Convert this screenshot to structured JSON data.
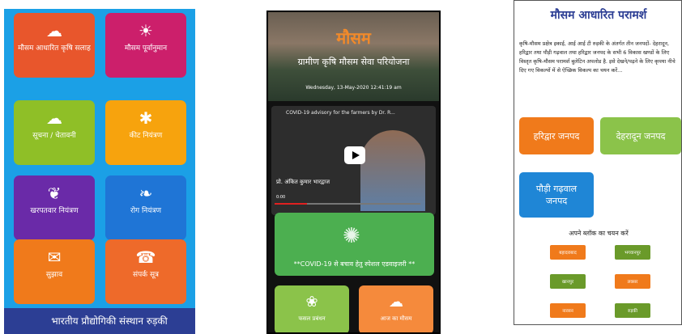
{
  "screen1": {
    "tiles": [
      {
        "label": "मौसम आधारित कृषि सलाह",
        "icon": "cloud-warning-icon",
        "color": "#e8562c"
      },
      {
        "label": "मौसम पूर्वानुमान",
        "icon": "weather-forecast-icon",
        "color": "#cc1f6b"
      },
      {
        "label": "सूचना / चेतावनी",
        "icon": "cloud-alert-icon",
        "color": "#8fbf27"
      },
      {
        "label": "कीट नियंत्रण",
        "icon": "insect-icon",
        "color": "#f7a30d"
      },
      {
        "label": "खरपतवार नियंत्रण",
        "icon": "weed-icon",
        "color": "#6a2aa8"
      },
      {
        "label": "रोग नियंत्रण",
        "icon": "plant-disease-icon",
        "color": "#1f75d6"
      },
      {
        "label": "सुझाव",
        "icon": "mail-icon",
        "color": "#f07a1b"
      },
      {
        "label": "संपर्क सूत्र",
        "icon": "phone-icon",
        "color": "#ee6a2a"
      }
    ],
    "footer": "भारतीय प्रौद्योगिकी संस्थान रुड़की"
  },
  "screen2": {
    "title": "मौसम",
    "subtitle": "ग्रामीण कृषि मौसम सेवा परियोजना",
    "date": "Wednesday, 13-May-2020 12:41:19 am",
    "video_title": "COVID-19 advisory for the farmers by Dr. R...",
    "video_caption": "प्रो. अंकित कुमार भारद्वाज",
    "video_time": "0:00",
    "covid_text": "**COVID-19 से बचाव हेतु स्पेशल एडवाइजरी **",
    "bottom_tiles": [
      {
        "label": "फसल प्रबंधन",
        "color": "#8bc34a"
      },
      {
        "label": "आज का मौसम",
        "color": "#f58a3c"
      }
    ]
  },
  "screen3": {
    "title": "मौसम आधारित परामर्श",
    "description": "कृषि-मौसम प्रक्षेत्र इकाई, आई आई टी रुड़की के अंतर्गत तीन जनपदों- देहरादून, हरिद्वार तथा पौड़ी गढ़वाल तथा हरिद्वार जनपद के सभी 6 विकास खण्डों के लिए विस्तृत कृषि-मौसम परामर्श बुलेटिन अपलोड है. इसे देखने/पढ़ने के लिए कृपया नीचे दिए गए विकल्पों में से ऐच्छिक विकल्प का चयन करें...",
    "districts": [
      {
        "label": "हरिद्वार जनपद",
        "color": "#f07a1b"
      },
      {
        "label": "देहरादून जनपद",
        "color": "#8bc34a"
      },
      {
        "label": "पौड़ी गढ़वाल जनपद",
        "color": "#1f86d6"
      }
    ],
    "block_label": "अपने ब्लॉक का चयन करें",
    "blocks": [
      {
        "label": "बहादराबाद",
        "color": "#f07a1b"
      },
      {
        "label": "भगवानपुर",
        "color": "#6a9a2a"
      },
      {
        "label": "खानपुर",
        "color": "#6a9a2a"
      },
      {
        "label": "लक्सर",
        "color": "#f07a1b"
      },
      {
        "label": "नारसन",
        "color": "#f07a1b"
      },
      {
        "label": "रुड़की",
        "color": "#6a9a2a"
      }
    ]
  }
}
